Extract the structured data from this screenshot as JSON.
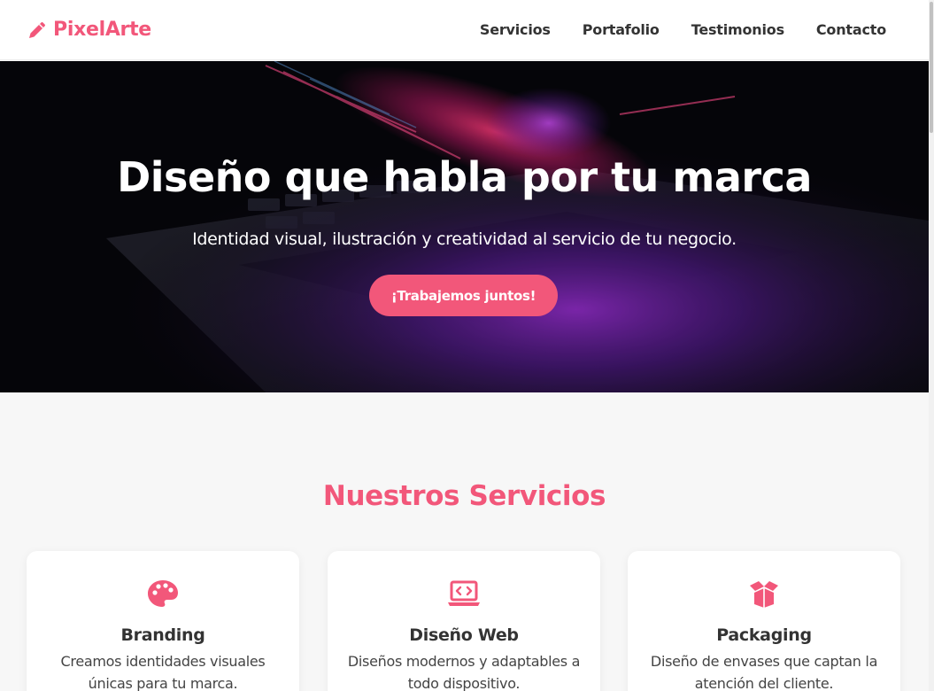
{
  "header": {
    "logo_text": "PixelArte",
    "logo_icon": "pencil-icon",
    "nav": [
      {
        "label": "Servicios"
      },
      {
        "label": "Portafolio"
      },
      {
        "label": "Testimonios"
      },
      {
        "label": "Contacto"
      }
    ]
  },
  "hero": {
    "title": "Diseño que habla por tu marca",
    "subtitle": "Identidad visual, ilustración y creatividad al servicio de tu negocio.",
    "cta_label": "¡Trabajemos juntos!"
  },
  "services": {
    "title": "Nuestros Servicios",
    "cards": [
      {
        "icon": "palette-icon",
        "title": "Branding",
        "description": "Creamos identidades visuales únicas para tu marca."
      },
      {
        "icon": "laptop-code-icon",
        "title": "Diseño Web",
        "description": "Diseños modernos y adaptables a todo dispositivo."
      },
      {
        "icon": "box-open-icon",
        "title": "Packaging",
        "description": "Diseño de envases que captan la atención del cliente."
      }
    ]
  },
  "colors": {
    "accent": "#f2577a",
    "header_bg": "#ffffff",
    "page_bg": "#f7f7f7",
    "hero_bg": "#07070c"
  }
}
